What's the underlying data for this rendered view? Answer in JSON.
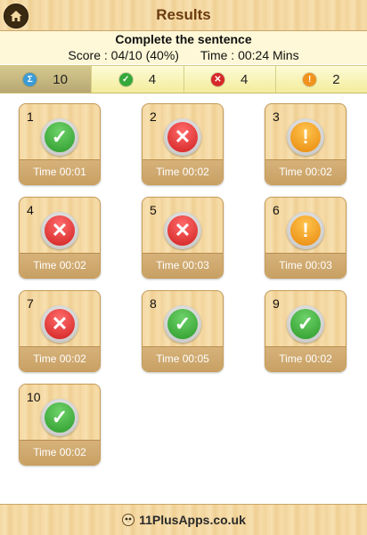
{
  "header": {
    "title": "Results"
  },
  "summary": {
    "subtitle": "Complete the sentence",
    "score": "Score : 04/10 (40%)",
    "time": "Time :  00:24 Mins"
  },
  "tabs": [
    {
      "icon": "sum-icon",
      "count": "10",
      "color": "#3a9bd6"
    },
    {
      "icon": "check-icon",
      "count": "4",
      "color": "#34a83a"
    },
    {
      "icon": "cross-icon",
      "count": "4",
      "color": "#d62828"
    },
    {
      "icon": "exclamation-icon",
      "count": "2",
      "color": "#f0921c"
    }
  ],
  "questions": [
    {
      "num": "1",
      "status": "correct",
      "time": "Time 00:01"
    },
    {
      "num": "2",
      "status": "wrong",
      "time": "Time 00:02"
    },
    {
      "num": "3",
      "status": "skipped",
      "time": "Time 00:02"
    },
    {
      "num": "4",
      "status": "wrong",
      "time": "Time 00:02"
    },
    {
      "num": "5",
      "status": "wrong",
      "time": "Time 00:03"
    },
    {
      "num": "6",
      "status": "skipped",
      "time": "Time 00:03"
    },
    {
      "num": "7",
      "status": "wrong",
      "time": "Time 00:02"
    },
    {
      "num": "8",
      "status": "correct",
      "time": "Time 00:05"
    },
    {
      "num": "9",
      "status": "correct",
      "time": "Time 00:02"
    },
    {
      "num": "10",
      "status": "correct",
      "time": "Time 00:02"
    }
  ],
  "footer": {
    "site": "11PlusApps.co.uk"
  }
}
